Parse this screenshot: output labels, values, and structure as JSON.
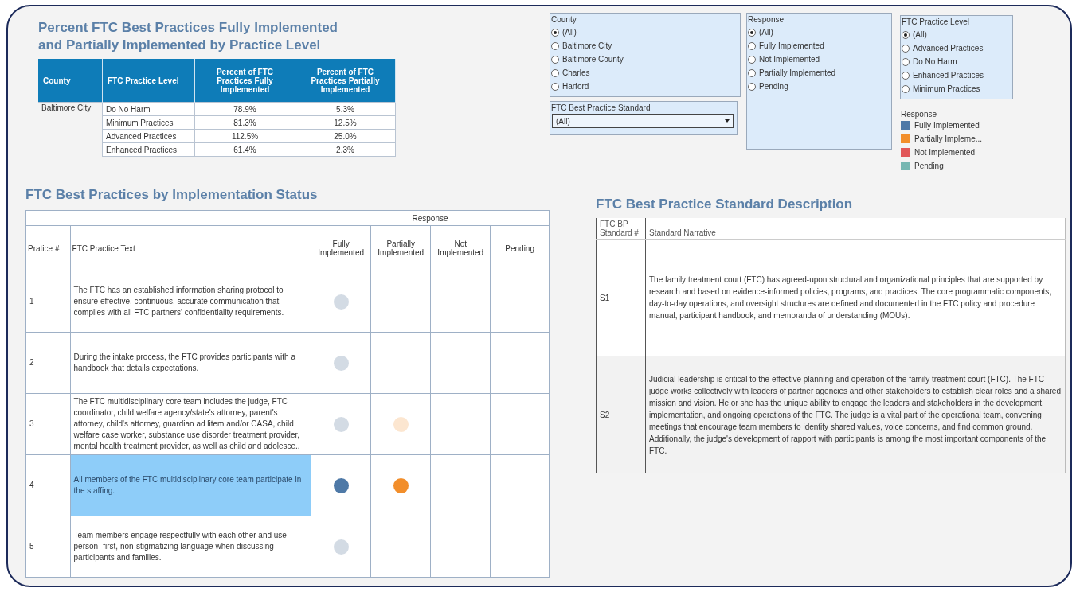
{
  "summary": {
    "title": "Percent FTC Best Practices Fully Implemented and Partially Implemented by Practice Level",
    "columns": [
      "County",
      "FTC Practice Level",
      "Percent of FTC Practices Fully Implemented",
      "Percent of FTC Practices Partially Implemented"
    ],
    "county": "Baltimore City",
    "rows": [
      {
        "level": "Do No Harm",
        "fully": "78.9%",
        "partially": "5.3%"
      },
      {
        "level": "Minimum Practices",
        "fully": "81.3%",
        "partially": "12.5%"
      },
      {
        "level": "Advanced Practices",
        "fully": "112.5%",
        "partially": "25.0%"
      },
      {
        "level": "Enhanced Practices",
        "fully": "61.4%",
        "partially": "2.3%"
      }
    ]
  },
  "filters": {
    "county": {
      "label": "County",
      "options": [
        {
          "label": "(All)",
          "selected": true
        },
        {
          "label": "Baltimore City",
          "selected": false
        },
        {
          "label": "Baltimore County",
          "selected": false
        },
        {
          "label": "Charles",
          "selected": false
        },
        {
          "label": "Harford",
          "selected": false
        }
      ]
    },
    "standard": {
      "label": "FTC Best Practice Standard",
      "value": "(All)"
    },
    "response": {
      "label": "Response",
      "options": [
        {
          "label": "(All)",
          "selected": true
        },
        {
          "label": "Fully Implemented",
          "selected": false
        },
        {
          "label": "Not Implemented",
          "selected": false
        },
        {
          "label": "Partially Implemented",
          "selected": false
        },
        {
          "label": "Pending",
          "selected": false
        }
      ]
    },
    "level": {
      "label": "FTC Practice Level",
      "options": [
        {
          "label": "(All)",
          "selected": true
        },
        {
          "label": "Advanced Practices",
          "selected": false
        },
        {
          "label": "Do No Harm",
          "selected": false
        },
        {
          "label": "Enhanced Practices",
          "selected": false
        },
        {
          "label": "Minimum Practices",
          "selected": false
        }
      ]
    }
  },
  "legend": {
    "title": "Response",
    "items": [
      {
        "label": "Fully Implemented",
        "color": "#4e79a7"
      },
      {
        "label": "Partially Impleme...",
        "color": "#f28e2b"
      },
      {
        "label": "Not Implemented",
        "color": "#e15759"
      },
      {
        "label": "Pending",
        "color": "#76b7b2"
      }
    ]
  },
  "practices": {
    "title": "FTC Best Practices by Implementation Status",
    "group_header": "Response",
    "columns": [
      "Pratice #",
      "FTC Practice Text",
      "Fully Implemented",
      "Partially Implemented",
      "Not Implemented",
      "Pending"
    ],
    "rows": [
      {
        "number": "1",
        "text": "The FTC has an established information sharing protocol to ensure effective, continuous, accurate communication that complies with all FTC partners' confidentiality requirements.",
        "selected": false,
        "fully": true,
        "partially": false,
        "not": false,
        "pending": false
      },
      {
        "number": "2",
        "text": "During the intake process, the FTC provides participants with a handbook that details expectations.",
        "selected": false,
        "fully": true,
        "partially": false,
        "not": false,
        "pending": false
      },
      {
        "number": "3",
        "text": "The FTC multidisciplinary core team includes the judge, FTC coordinator, child welfare agency/state's attorney, parent's attorney, child's attorney, guardian ad litem and/or CASA, child welfare case worker, substance use disorder treatment provider, mental health treatment provider, as well as child and adolesce..",
        "selected": false,
        "fully": true,
        "partially": true,
        "not": false,
        "pending": false
      },
      {
        "number": "4",
        "text": "All members of the FTC multidisciplinary core team participate in the staffing.",
        "selected": true,
        "fully": true,
        "partially": true,
        "not": false,
        "pending": false
      },
      {
        "number": "5",
        "text": "Team members engage respectfully with each other and use person- first, non-stigmatizing language when discussing participants and families.",
        "selected": false,
        "fully": true,
        "partially": false,
        "not": false,
        "pending": false
      }
    ]
  },
  "descriptions": {
    "title": "FTC Best Practice Standard Description",
    "columns": [
      "FTC BP Standard #",
      "Standard Narrative"
    ],
    "rows": [
      {
        "number": "S1",
        "text": "The family treatment court (FTC) has agreed-upon structural and organizational principles that are supported by research and based on evidence-informed policies, programs, and practices. The core programmatic components, day-to-day operations, and oversight structures are defined and documented in the FTC policy and procedure manual, participant handbook, and memoranda of understanding (MOUs)."
      },
      {
        "number": "S2",
        "text": "Judicial leadership is critical to the effective planning and operation of the family treatment court (FTC). The FTC judge works collectively with leaders of partner agencies and other stakeholders to establish clear roles and a shared mission and vision. He or she has the unique ability to engage the leaders and stakeholders in the development, implementation, and ongoing operations of the FTC. The judge is a vital part of the operational team, convening meetings that encourage team members to identify shared values, voice concerns, and find common ground. Additionally, the judge's development of rapport with participants is among the most important components of the FTC."
      }
    ]
  }
}
